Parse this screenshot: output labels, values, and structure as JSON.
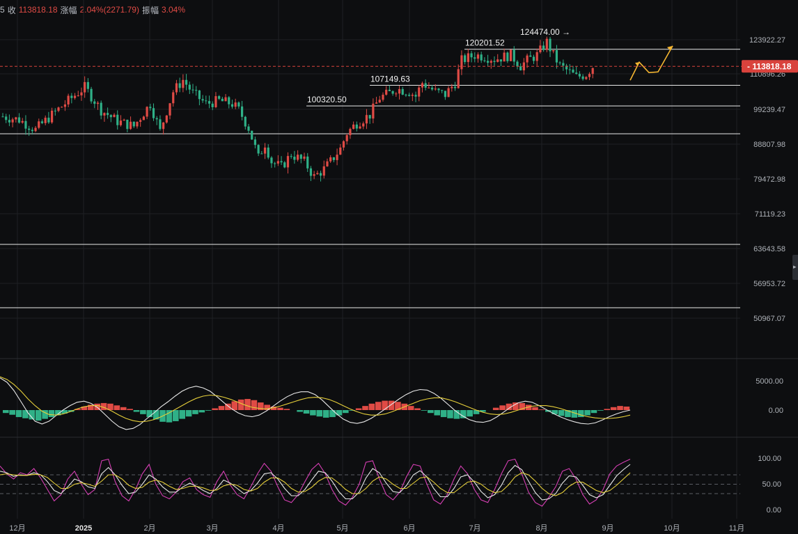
{
  "header": {
    "prefix": "5",
    "close_label": "收",
    "close_value": "113818.18",
    "change_label": "涨幅",
    "change_value": "2.04%(2271.79)",
    "amplitude_label": "振幅",
    "amplitude_value": "3.04%"
  },
  "colors": {
    "up": "#e04b45",
    "down": "#2fb087",
    "background": "#0d0e10",
    "grid": "#1e2024",
    "annotation_arrow": "#f5b631",
    "price_tag": "#d9423c"
  },
  "chart_data": [
    {
      "type": "candlestick",
      "name": "price",
      "y_ticks": [
        "123922.27",
        "110896.26",
        "99239.47",
        "88807.98",
        "79472.98",
        "71119.23",
        "63643.58",
        "56953.72",
        "50967.07"
      ],
      "y_scale": "log",
      "x_labels": [
        "12月",
        "2025",
        "2月",
        "3月",
        "4月",
        "5月",
        "6月",
        "7月",
        "8月",
        "9月",
        "10月",
        "11月"
      ],
      "current_price": "113818.18",
      "annotations": [
        {
          "text": "100320.50",
          "value": 100320.5
        },
        {
          "text": "107149.63",
          "value": 107149.63
        },
        {
          "text": "120201.52",
          "value": 120201.52
        },
        {
          "text": "124474.00",
          "value": 124474.0,
          "arrow": "→"
        }
      ],
      "horizontal_levels": [
        120201.52,
        107149.63,
        100320.5,
        91800,
        64500,
        52700
      ],
      "candles_close_path": [
        [
          0,
          97000
        ],
        [
          5,
          96000
        ],
        [
          10,
          93000
        ],
        [
          15,
          97500
        ],
        [
          20,
          102000
        ],
        [
          25,
          106500
        ],
        [
          30,
          99000
        ],
        [
          35,
          95500
        ],
        [
          40,
          94000
        ],
        [
          45,
          101000
        ],
        [
          48,
          92500
        ],
        [
          52,
          105000
        ],
        [
          55,
          109000
        ],
        [
          58,
          104500
        ],
        [
          62,
          101000
        ],
        [
          66,
          102000
        ],
        [
          70,
          101000
        ],
        [
          72,
          99000
        ],
        [
          75,
          93500
        ],
        [
          78,
          85000
        ],
        [
          80,
          89000
        ],
        [
          82,
          84000
        ],
        [
          85,
          82500
        ],
        [
          88,
          86000
        ],
        [
          92,
          84000
        ],
        [
          95,
          80000
        ],
        [
          98,
          82000
        ],
        [
          100,
          84000
        ],
        [
          103,
          87500
        ],
        [
          105,
          92000
        ],
        [
          108,
          95000
        ],
        [
          112,
          97500
        ],
        [
          115,
          103000
        ],
        [
          118,
          104500
        ],
        [
          120,
          106000
        ],
        [
          124,
          105000
        ],
        [
          126,
          103500
        ],
        [
          128,
          108000
        ],
        [
          132,
          105000
        ],
        [
          135,
          104000
        ],
        [
          138,
          108000
        ],
        [
          140,
          116000
        ],
        [
          144,
          118000
        ],
        [
          147,
          117500
        ],
        [
          150,
          116500
        ],
        [
          155,
          118000
        ],
        [
          158,
          114000
        ],
        [
          160,
          116000
        ],
        [
          163,
          118000
        ],
        [
          166,
          123000
        ],
        [
          168,
          118000
        ],
        [
          170,
          114000
        ],
        [
          172,
          112500
        ],
        [
          175,
          110000
        ],
        [
          178,
          111000
        ],
        [
          180,
          113818
        ]
      ],
      "x_domain": [
        0,
        225
      ]
    },
    {
      "type": "macd",
      "name": "macd",
      "y_ticks": [
        "5000.00",
        "0.00"
      ],
      "histogram": [
        -500,
        -800,
        -1200,
        -1400,
        -1600,
        -1800,
        -1500,
        -1200,
        -900,
        -600,
        -300,
        200,
        600,
        900,
        1100,
        1200,
        1100,
        800,
        500,
        200,
        -300,
        -700,
        -1200,
        -1600,
        -2000,
        -2100,
        -1900,
        -1500,
        -1100,
        -700,
        -400,
        -100,
        300,
        700,
        1100,
        1500,
        1800,
        1900,
        1700,
        1300,
        900,
        600,
        400,
        200,
        0,
        -300,
        -600,
        -900,
        -1100,
        -1300,
        -1200,
        -900,
        -500,
        -100,
        300,
        700,
        1100,
        1400,
        1600,
        1600,
        1400,
        1100,
        700,
        300,
        -100,
        -500,
        -900,
        -1200,
        -1400,
        -1500,
        -1400,
        -1100,
        -700,
        -300,
        0,
        400,
        800,
        1100,
        1300,
        1200,
        900,
        500,
        100,
        -300,
        -700,
        -1000,
        -1200,
        -1300,
        -1200,
        -900,
        -500,
        -100,
        200,
        500,
        700,
        600
      ],
      "dif": [
        5800,
        5000,
        3500,
        1500,
        -500,
        -2000,
        -2500,
        -2000,
        -1000,
        0,
        800,
        1400,
        1600,
        1200,
        400,
        -800,
        -2000,
        -3000,
        -3500,
        -3300,
        -2600,
        -1500,
        -500,
        600,
        1500,
        2500,
        3400,
        4000,
        4300,
        4000,
        3400,
        2400,
        1300,
        300,
        -500,
        -1000,
        -1200,
        -900,
        -200,
        700,
        1600,
        2400,
        3000,
        3300,
        3300,
        2800,
        1800,
        600,
        -600,
        -1600,
        -2200,
        -2400,
        -2100,
        -1500,
        -700,
        200,
        1100,
        2000,
        2800,
        3400,
        3700,
        3600,
        3000,
        2100,
        1000,
        -100,
        -1000,
        -1700,
        -2100,
        -2200,
        -1900,
        -1200,
        -300,
        600,
        1300,
        1600,
        1400,
        800,
        100,
        -600,
        -1200,
        -1700,
        -2100,
        -2400,
        -2500,
        -2300,
        -1800,
        -1200,
        -700,
        -300,
        0
      ],
      "dea": [
        6000,
        5500,
        4600,
        3400,
        2000,
        800,
        -200,
        -800,
        -900,
        -700,
        -300,
        200,
        600,
        800,
        800,
        400,
        -200,
        -900,
        -1500,
        -1900,
        -2100,
        -2000,
        -1700,
        -1200,
        -600,
        100,
        800,
        1500,
        2100,
        2500,
        2700,
        2600,
        2300,
        1900,
        1400,
        900,
        500,
        300,
        200,
        400,
        700,
        1100,
        1500,
        1900,
        2200,
        2300,
        2200,
        1900,
        1400,
        800,
        200,
        -300,
        -700,
        -900,
        -900,
        -700,
        -300,
        200,
        700,
        1200,
        1700,
        2000,
        2200,
        2200,
        1900,
        1500,
        1000,
        500,
        0,
        -400,
        -700,
        -800,
        -700,
        -400,
        0,
        400,
        700,
        800,
        800,
        600,
        300,
        -100,
        -500,
        -900,
        -1200,
        -1400,
        -1500,
        -1500,
        -1400,
        -1200,
        -900
      ]
    },
    {
      "type": "line",
      "name": "kdj",
      "y_ticks": [
        "100.00",
        "50.00",
        "0.00"
      ],
      "dashed_levels": [
        80,
        50,
        20
      ],
      "series": [
        {
          "color": "#d63fb4",
          "values": [
            85,
            70,
            60,
            72,
            68,
            80,
            62,
            40,
            18,
            30,
            60,
            75,
            50,
            30,
            40,
            95,
            98,
            55,
            28,
            18,
            40,
            70,
            88,
            50,
            28,
            22,
            35,
            55,
            62,
            40,
            30,
            25,
            55,
            75,
            48,
            30,
            22,
            45,
            70,
            90,
            75,
            45,
            20,
            15,
            30,
            55,
            78,
            90,
            70,
            40,
            18,
            10,
            25,
            50,
            92,
            95,
            60,
            30,
            20,
            35,
            65,
            88,
            85,
            50,
            20,
            12,
            30,
            60,
            85,
            70,
            40,
            20,
            15,
            40,
            70,
            95,
            98,
            70,
            35,
            15,
            8,
            25,
            45,
            75,
            80,
            60,
            30,
            12,
            20,
            40,
            70,
            85,
            92,
            98
          ]
        },
        {
          "color": "#e8e8e8",
          "values": [
            75,
            72,
            65,
            68,
            67,
            72,
            68,
            55,
            38,
            32,
            45,
            60,
            55,
            45,
            42,
            70,
            82,
            68,
            48,
            32,
            35,
            50,
            68,
            60,
            45,
            35,
            35,
            45,
            52,
            46,
            38,
            32,
            42,
            58,
            52,
            42,
            32,
            38,
            52,
            70,
            72,
            60,
            42,
            28,
            28,
            40,
            58,
            75,
            72,
            56,
            36,
            22,
            22,
            35,
            62,
            80,
            72,
            52,
            36,
            34,
            48,
            68,
            76,
            64,
            42,
            26,
            26,
            42,
            64,
            68,
            54,
            36,
            24,
            30,
            48,
            72,
            86,
            78,
            56,
            34,
            20,
            22,
            32,
            52,
            66,
            64,
            48,
            30,
            24,
            30,
            48,
            66,
            78,
            88
          ]
        },
        {
          "color": "#e6cf3a",
          "values": [
            68,
            70,
            68,
            67,
            67,
            69,
            68,
            63,
            52,
            42,
            42,
            50,
            53,
            50,
            46,
            56,
            68,
            68,
            60,
            48,
            42,
            44,
            54,
            58,
            54,
            46,
            40,
            42,
            46,
            46,
            43,
            38,
            39,
            47,
            50,
            48,
            40,
            37,
            42,
            54,
            62,
            62,
            54,
            42,
            35,
            36,
            44,
            56,
            63,
            62,
            52,
            40,
            32,
            32,
            42,
            56,
            64,
            60,
            50,
            42,
            42,
            52,
            62,
            64,
            54,
            42,
            34,
            34,
            44,
            54,
            56,
            50,
            40,
            34,
            36,
            48,
            64,
            72,
            68,
            56,
            42,
            32,
            28,
            34,
            46,
            54,
            54,
            46,
            38,
            34,
            38,
            48,
            60,
            72
          ]
        }
      ]
    }
  ]
}
